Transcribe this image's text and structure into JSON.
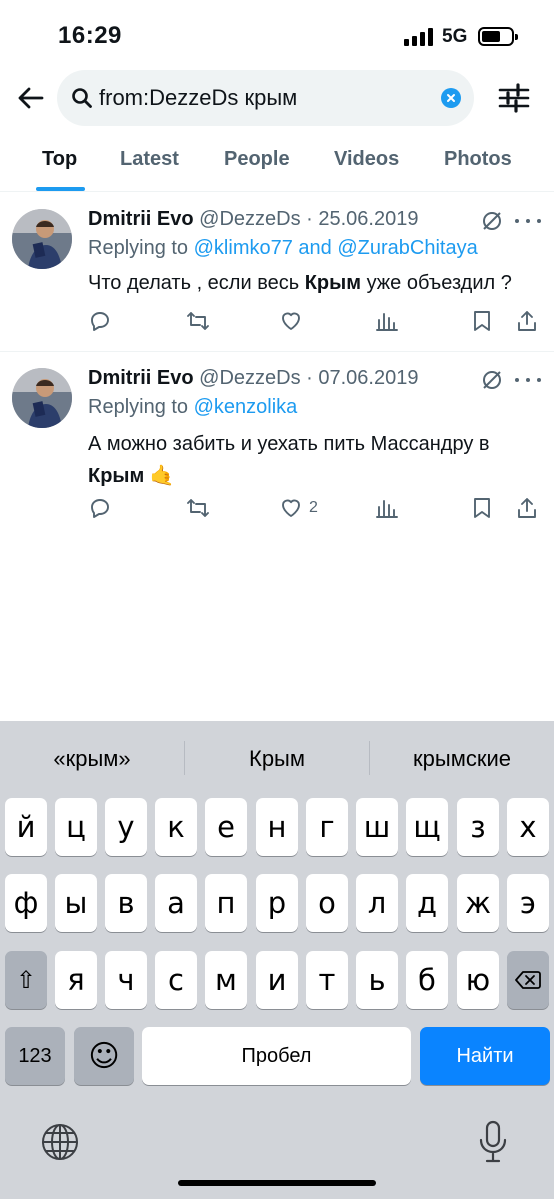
{
  "status_bar": {
    "time": "16:29",
    "network": "5G"
  },
  "search": {
    "query": "from:DezzeDs крым"
  },
  "tabs": [
    "Top",
    "Latest",
    "People",
    "Videos",
    "Photos"
  ],
  "tweets": [
    {
      "name": "Dmitrii Evo",
      "handle": "@DezzeDs",
      "date": "· 25.06.2019",
      "replying_to_prefix": "Replying to",
      "replying_to_1": "@klimko77",
      "replying_to_and": "and",
      "replying_to_2": "@ZurabChitaya",
      "text_before": "Что делать , если весь ",
      "text_bold": "Крым",
      "text_after": " уже объездил ?",
      "likes": ""
    },
    {
      "name": "Dmitrii Evo",
      "handle": "@DezzeDs",
      "date": "· 07.06.2019",
      "replying_to_prefix": "Replying to",
      "replying_to_1": "@kenzolika",
      "text_line1": "А можно забить и уехать пить Массандру в",
      "text_bold": "Крым",
      "emoji": "🤙",
      "likes": "2"
    }
  ],
  "keyboard": {
    "suggestions": [
      "«крым»",
      "Крым",
      "крымские"
    ],
    "row1": [
      "й",
      "ц",
      "у",
      "к",
      "е",
      "н",
      "г",
      "ш",
      "щ",
      "з",
      "х"
    ],
    "row2": [
      "ф",
      "ы",
      "в",
      "а",
      "п",
      "р",
      "о",
      "л",
      "д",
      "ж",
      "э"
    ],
    "row3": [
      "я",
      "ч",
      "с",
      "м",
      "и",
      "т",
      "ь",
      "б",
      "ю"
    ],
    "numbers_label": "123",
    "space_label": "Пробел",
    "return_label": "Найти",
    "shift_symbol": "⇧",
    "emoji_symbol": "☺"
  }
}
